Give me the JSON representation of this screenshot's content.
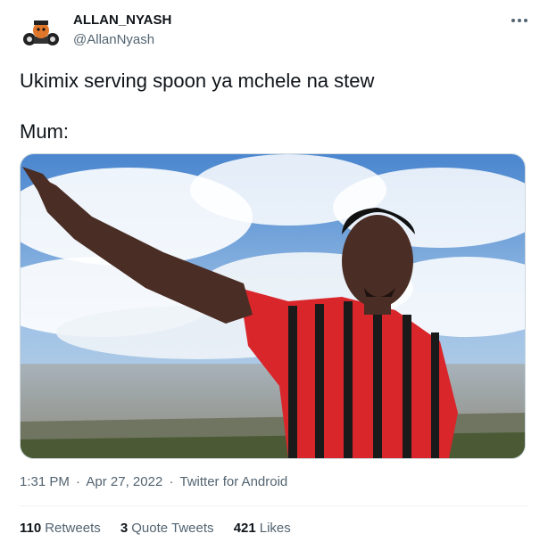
{
  "author": {
    "name": "ALLAN_NYASH",
    "handle": "@AllanNyash"
  },
  "tweet": {
    "line1": "Ukimix serving spoon ya mchele na stew",
    "line2": "Mum:"
  },
  "meta": {
    "time": "1:31 PM",
    "sep1": "·",
    "date": "Apr 27, 2022",
    "sep2": "·",
    "source": "Twitter for Android"
  },
  "stats": [
    {
      "count": "110",
      "label": "Retweets"
    },
    {
      "count": "3",
      "label": "Quote Tweets"
    },
    {
      "count": "421",
      "label": "Likes"
    }
  ],
  "icons": {
    "more": "more-icon",
    "avatar": "avatar"
  },
  "colors": {
    "text": "#0f1419",
    "secondary": "#536471",
    "border": "#cfd9de"
  }
}
